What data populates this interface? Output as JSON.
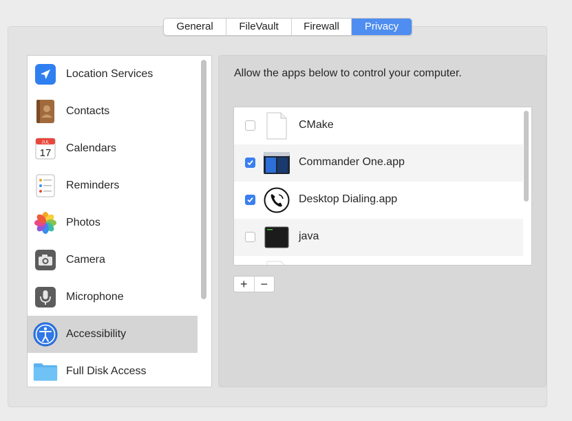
{
  "tabs": [
    {
      "label": "General",
      "active": false
    },
    {
      "label": "FileVault",
      "active": false
    },
    {
      "label": "Firewall",
      "active": false
    },
    {
      "label": "Privacy",
      "active": true
    }
  ],
  "sidebar": {
    "items": [
      {
        "label": "Location Services",
        "icon": "location-arrow-icon"
      },
      {
        "label": "Contacts",
        "icon": "contacts-book-icon"
      },
      {
        "label": "Calendars",
        "icon": "calendar-icon",
        "icon_month": "JUL",
        "icon_day": "17"
      },
      {
        "label": "Reminders",
        "icon": "reminders-list-icon"
      },
      {
        "label": "Photos",
        "icon": "photos-flower-icon"
      },
      {
        "label": "Camera",
        "icon": "camera-icon"
      },
      {
        "label": "Microphone",
        "icon": "microphone-icon"
      },
      {
        "label": "Accessibility",
        "icon": "accessibility-icon",
        "selected": true
      },
      {
        "label": "Full Disk Access",
        "icon": "folder-icon"
      }
    ]
  },
  "main": {
    "prompt": "Allow the apps below to control your computer.",
    "apps": [
      {
        "name": "CMake",
        "checked": false,
        "icon": "blank-document-icon"
      },
      {
        "name": "Commander One.app",
        "checked": true,
        "icon": "commander-one-icon"
      },
      {
        "name": "Desktop Dialing.app",
        "checked": true,
        "icon": "phone-handset-icon"
      },
      {
        "name": "java",
        "checked": false,
        "icon": "terminal-exec-icon"
      }
    ],
    "add_label": "+",
    "remove_label": "−"
  },
  "colors": {
    "accent": "#4f8ef0",
    "checkbox_checked": "#3a7ff0",
    "selected_row": "#d5d5d5"
  }
}
